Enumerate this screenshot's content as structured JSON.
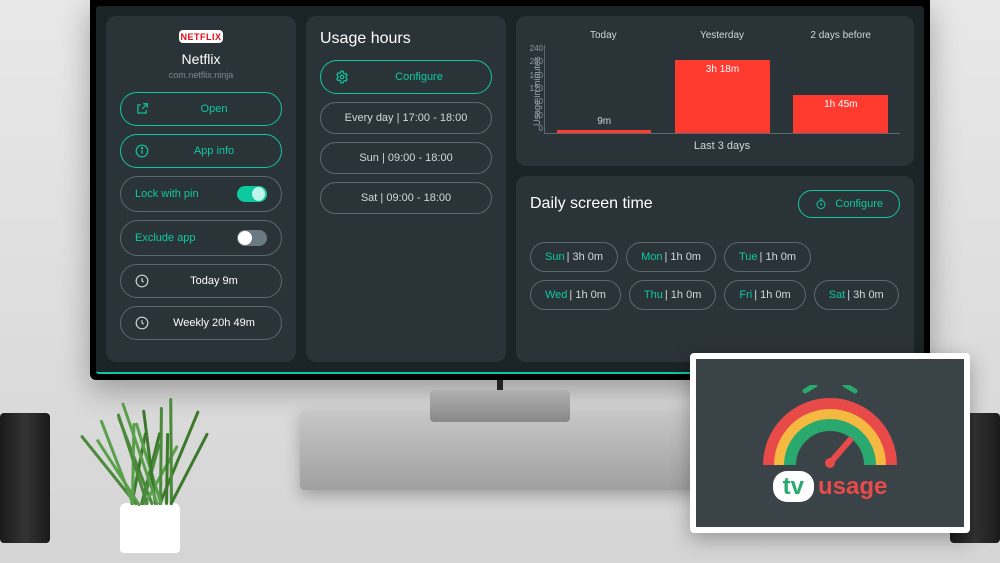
{
  "app": {
    "logo_text": "NETFLIX",
    "name": "Netflix",
    "package": "com.netflix.ninja"
  },
  "left_actions": {
    "open_label": "Open",
    "appinfo_label": "App info",
    "lockpin_label": "Lock with pin",
    "lockpin_on": true,
    "exclude_label": "Exclude app",
    "exclude_on": false,
    "today_label": "Today 9m",
    "weekly_label": "Weekly 20h 49m"
  },
  "usage_hours": {
    "title": "Usage hours",
    "configure_label": "Configure",
    "rules": [
      "Every day | 17:00 - 18:00",
      "Sun | 09:00 - 18:00",
      "Sat | 09:00 - 18:00"
    ]
  },
  "chart_data": {
    "type": "bar",
    "title": "Last 3 days",
    "ylabel": "Usage in minutes",
    "ylim": [
      0,
      240
    ],
    "yticks": [
      240,
      200,
      160,
      120,
      80,
      40,
      0
    ],
    "categories": [
      "Today",
      "Yesterday",
      "2 days before"
    ],
    "values": [
      9,
      198,
      105
    ],
    "value_labels": [
      "9m",
      "3h 18m",
      "1h 45m"
    ]
  },
  "daily": {
    "title": "Daily screen time",
    "configure_label": "Configure",
    "days": [
      {
        "name": "Sun",
        "value": "3h 0m"
      },
      {
        "name": "Mon",
        "value": "1h 0m"
      },
      {
        "name": "Tue",
        "value": "1h 0m"
      },
      {
        "name": "Wed",
        "value": "1h 0m"
      },
      {
        "name": "Thu",
        "value": "1h 0m"
      },
      {
        "name": "Fri",
        "value": "1h 0m"
      },
      {
        "name": "Sat",
        "value": "3h 0m"
      }
    ]
  },
  "badge": {
    "tv": "tv",
    "usage": "usage"
  },
  "colors": {
    "accent": "#0ec9a0",
    "bar": "#ff3b30"
  }
}
